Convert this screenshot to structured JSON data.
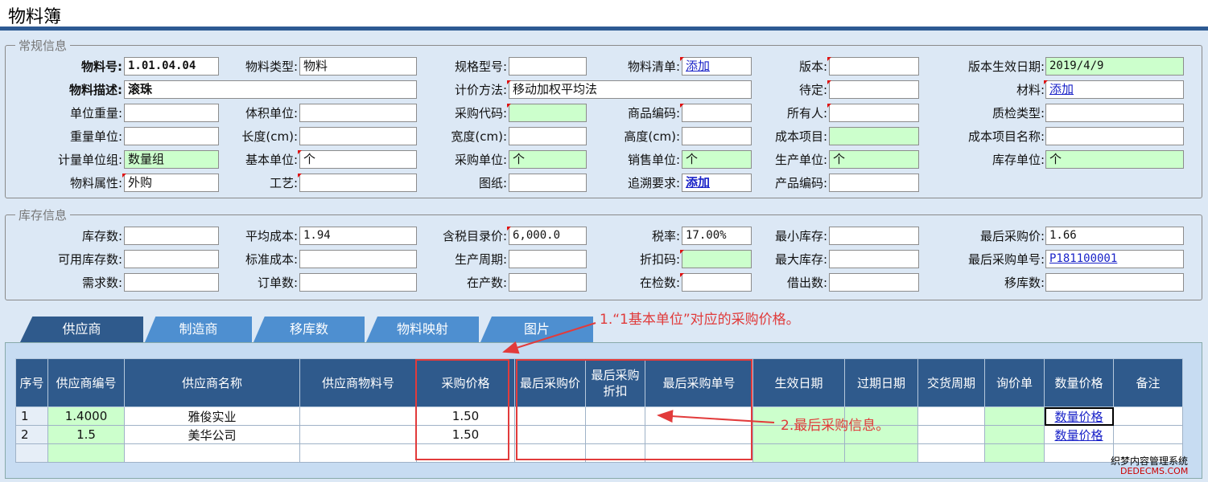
{
  "title": "物料簿",
  "sections": {
    "general": "常规信息",
    "stock": "库存信息"
  },
  "general": {
    "material_no_label": "物料号:",
    "material_no": "1.01.04.04",
    "material_type_label": "物料类型:",
    "material_type": "物料",
    "spec_label": "规格型号:",
    "spec": "",
    "bom_label": "物料清单:",
    "bom_link": "添加",
    "version_label": "版本:",
    "version": "",
    "version_date_label": "版本生效日期:",
    "version_date": "2019/4/9",
    "desc_label": "物料描述:",
    "desc": "滚珠",
    "pricing_label": "计价方法:",
    "pricing": "移动加权平均法",
    "pending_label": "待定:",
    "pending": "",
    "material_label": "材料:",
    "material_link": "添加",
    "unit_weight_label": "单位重量:",
    "unit_weight": "",
    "volume_unit_label": "体积单位:",
    "volume_unit": "",
    "purchase_code_label": "采购代码:",
    "purchase_code": "",
    "product_code_label": "商品编码:",
    "product_code": "",
    "owner_label": "所有人:",
    "owner": "",
    "qc_type_label": "质检类型:",
    "qc_type": "",
    "weight_unit_label": "重量单位:",
    "weight_unit": "",
    "length_label": "长度(cm):",
    "length": "",
    "width_label": "宽度(cm):",
    "width": "",
    "height_label": "高度(cm):",
    "height": "",
    "cost_item_label": "成本项目:",
    "cost_item": "",
    "cost_item_name_label": "成本项目名称:",
    "cost_item_name": "",
    "uom_group_label": "计量单位组:",
    "uom_group": "数量组",
    "base_unit_label": "基本单位:",
    "base_unit": "个",
    "purchase_unit_label": "采购单位:",
    "purchase_unit": "个",
    "sales_unit_label": "销售单位:",
    "sales_unit": "个",
    "production_unit_label": "生产单位:",
    "production_unit": "个",
    "stock_unit_label": "库存单位:",
    "stock_unit": "个",
    "attr_label": "物料属性:",
    "attr": "外购",
    "process_label": "工艺:",
    "process": "",
    "drawing_label": "图纸:",
    "drawing": "",
    "trace_label": "追溯要求:",
    "trace_link": "添加",
    "product_no_label": "产品编码:",
    "product_no": ""
  },
  "stock": {
    "qty_label": "库存数:",
    "qty": "",
    "avg_cost_label": "平均成本:",
    "avg_cost": "1.94",
    "list_price_label": "含税目录价:",
    "list_price": "6,000.0",
    "tax_label": "税率:",
    "tax": "17.00%",
    "min_stock_label": "最小库存:",
    "min_stock": "",
    "last_price_label": "最后采购价:",
    "last_price": "1.66",
    "avail_label": "可用库存数:",
    "avail": "",
    "std_cost_label": "标准成本:",
    "std_cost": "",
    "prod_cycle_label": "生产周期:",
    "prod_cycle": "",
    "discount_label": "折扣码:",
    "discount": "",
    "max_stock_label": "最大库存:",
    "max_stock": "",
    "last_po_label": "最后采购单号:",
    "last_po": "P181100001",
    "demand_label": "需求数:",
    "demand": "",
    "order_label": "订单数:",
    "order": "",
    "wip_label": "在产数:",
    "wip": "",
    "inspect_label": "在检数:",
    "inspect": "",
    "loan_label": "借出数:",
    "loan": "",
    "transfer_label": "移库数:",
    "transfer": ""
  },
  "tabs": [
    "供应商",
    "制造商",
    "移库数",
    "物料映射",
    "图片"
  ],
  "grid": {
    "headers": [
      "序号",
      "供应商编号",
      "供应商名称",
      "供应商物料号",
      "采购价格",
      "最后采购价",
      "最后采购折扣",
      "最后采购单号",
      "生效日期",
      "过期日期",
      "交货周期",
      "询价单",
      "数量价格",
      "备注"
    ],
    "rows": [
      {
        "no": "1",
        "code": "1.4000",
        "name": "雅俊实业",
        "part": "",
        "price": "1.50",
        "last_price": "",
        "last_disc": "",
        "last_po": "",
        "eff": "",
        "exp": "",
        "lead": "",
        "rfq": "",
        "qty_price": "数量价格",
        "note": ""
      },
      {
        "no": "2",
        "code": "1.5",
        "name": "美华公司",
        "part": "",
        "price": "1.50",
        "last_price": "",
        "last_disc": "",
        "last_po": "",
        "eff": "",
        "exp": "",
        "lead": "",
        "rfq": "",
        "qty_price": "数量价格",
        "note": ""
      }
    ]
  },
  "annotations": {
    "note1": "1.“1基本单位”对应的采购价格。",
    "note2": "2.最后采购信息。"
  },
  "watermark": {
    "line1": "织梦内容管理系统",
    "line2": "DEDECMS.COM"
  },
  "colors": {
    "header": "#2f5a8c",
    "green": "#ccffcc",
    "annotation": "#e23b3b"
  }
}
